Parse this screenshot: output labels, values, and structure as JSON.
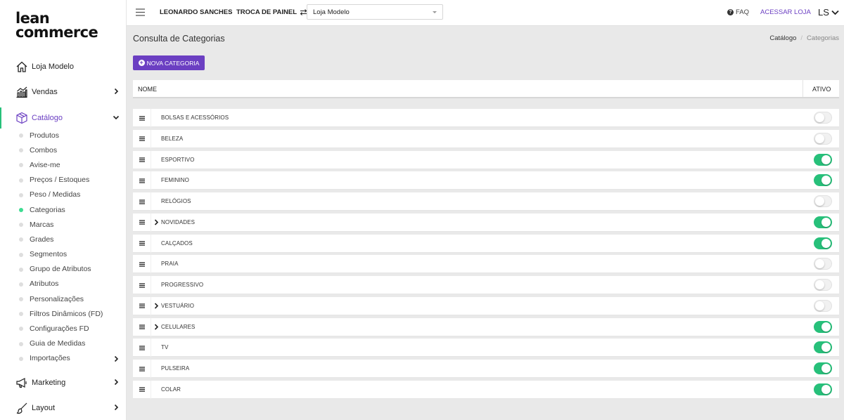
{
  "brand": {
    "logo_line1": "lean",
    "logo_line2": "commerce",
    "accent": "#6b3fc2",
    "success": "#27c07a"
  },
  "sidebar": {
    "main": [
      {
        "label": "Loja Modelo",
        "icon": "home-icon"
      },
      {
        "label": "Vendas",
        "icon": "chart-icon"
      },
      {
        "label": "Catálogo",
        "icon": "box-icon"
      },
      {
        "label": "Marketing",
        "icon": "megaphone-icon"
      },
      {
        "label": "Layout",
        "icon": "brush-icon"
      }
    ],
    "catalog_items": [
      {
        "label": "Produtos"
      },
      {
        "label": "Combos"
      },
      {
        "label": "Avise-me"
      },
      {
        "label": "Preços / Estoques"
      },
      {
        "label": "Peso / Medidas"
      },
      {
        "label": "Categorias",
        "active": true
      },
      {
        "label": "Marcas"
      },
      {
        "label": "Grades"
      },
      {
        "label": "Segmentos"
      },
      {
        "label": "Grupo de Atributos"
      },
      {
        "label": "Atributos"
      },
      {
        "label": "Personalizações"
      },
      {
        "label": "Filtros Dinâmicos (FD)"
      },
      {
        "label": "Configurações FD"
      },
      {
        "label": "Guia de Medidas"
      },
      {
        "label": "Importações"
      }
    ]
  },
  "topbar": {
    "user_name": "LEONARDO SANCHES",
    "switch_label": "TROCA DE PAINEL",
    "store_selected": "Loja Modelo",
    "faq_label": "FAQ",
    "store_link": "ACESSAR LOJA",
    "user_initials": "LS"
  },
  "page": {
    "title": "Consulta de Categorias",
    "breadcrumb": [
      "Catálogo",
      "Categorias"
    ],
    "new_button": "NOVA CATEGORIA"
  },
  "table": {
    "columns": {
      "name": "NOME",
      "active": "ATIVO"
    },
    "rows": [
      {
        "name": "BOLSAS E ACESSÓRIOS",
        "active": false,
        "expandable": false
      },
      {
        "name": "BELEZA",
        "active": false,
        "expandable": false
      },
      {
        "name": "ESPORTIVO",
        "active": true,
        "expandable": false
      },
      {
        "name": "FEMININO",
        "active": true,
        "expandable": false
      },
      {
        "name": "RELÓGIOS",
        "active": false,
        "expandable": false
      },
      {
        "name": "NOVIDADES",
        "active": true,
        "expandable": true
      },
      {
        "name": "CALÇADOS",
        "active": true,
        "expandable": false
      },
      {
        "name": "PRAIA",
        "active": false,
        "expandable": false
      },
      {
        "name": "PROGRESSIVO",
        "active": false,
        "expandable": false
      },
      {
        "name": "VESTUÁRIO",
        "active": false,
        "expandable": true
      },
      {
        "name": "CELULARES",
        "active": true,
        "expandable": true
      },
      {
        "name": "TV",
        "active": true,
        "expandable": false
      },
      {
        "name": "PULSEIRA",
        "active": true,
        "expandable": false
      },
      {
        "name": "COLAR",
        "active": true,
        "expandable": false
      }
    ]
  }
}
